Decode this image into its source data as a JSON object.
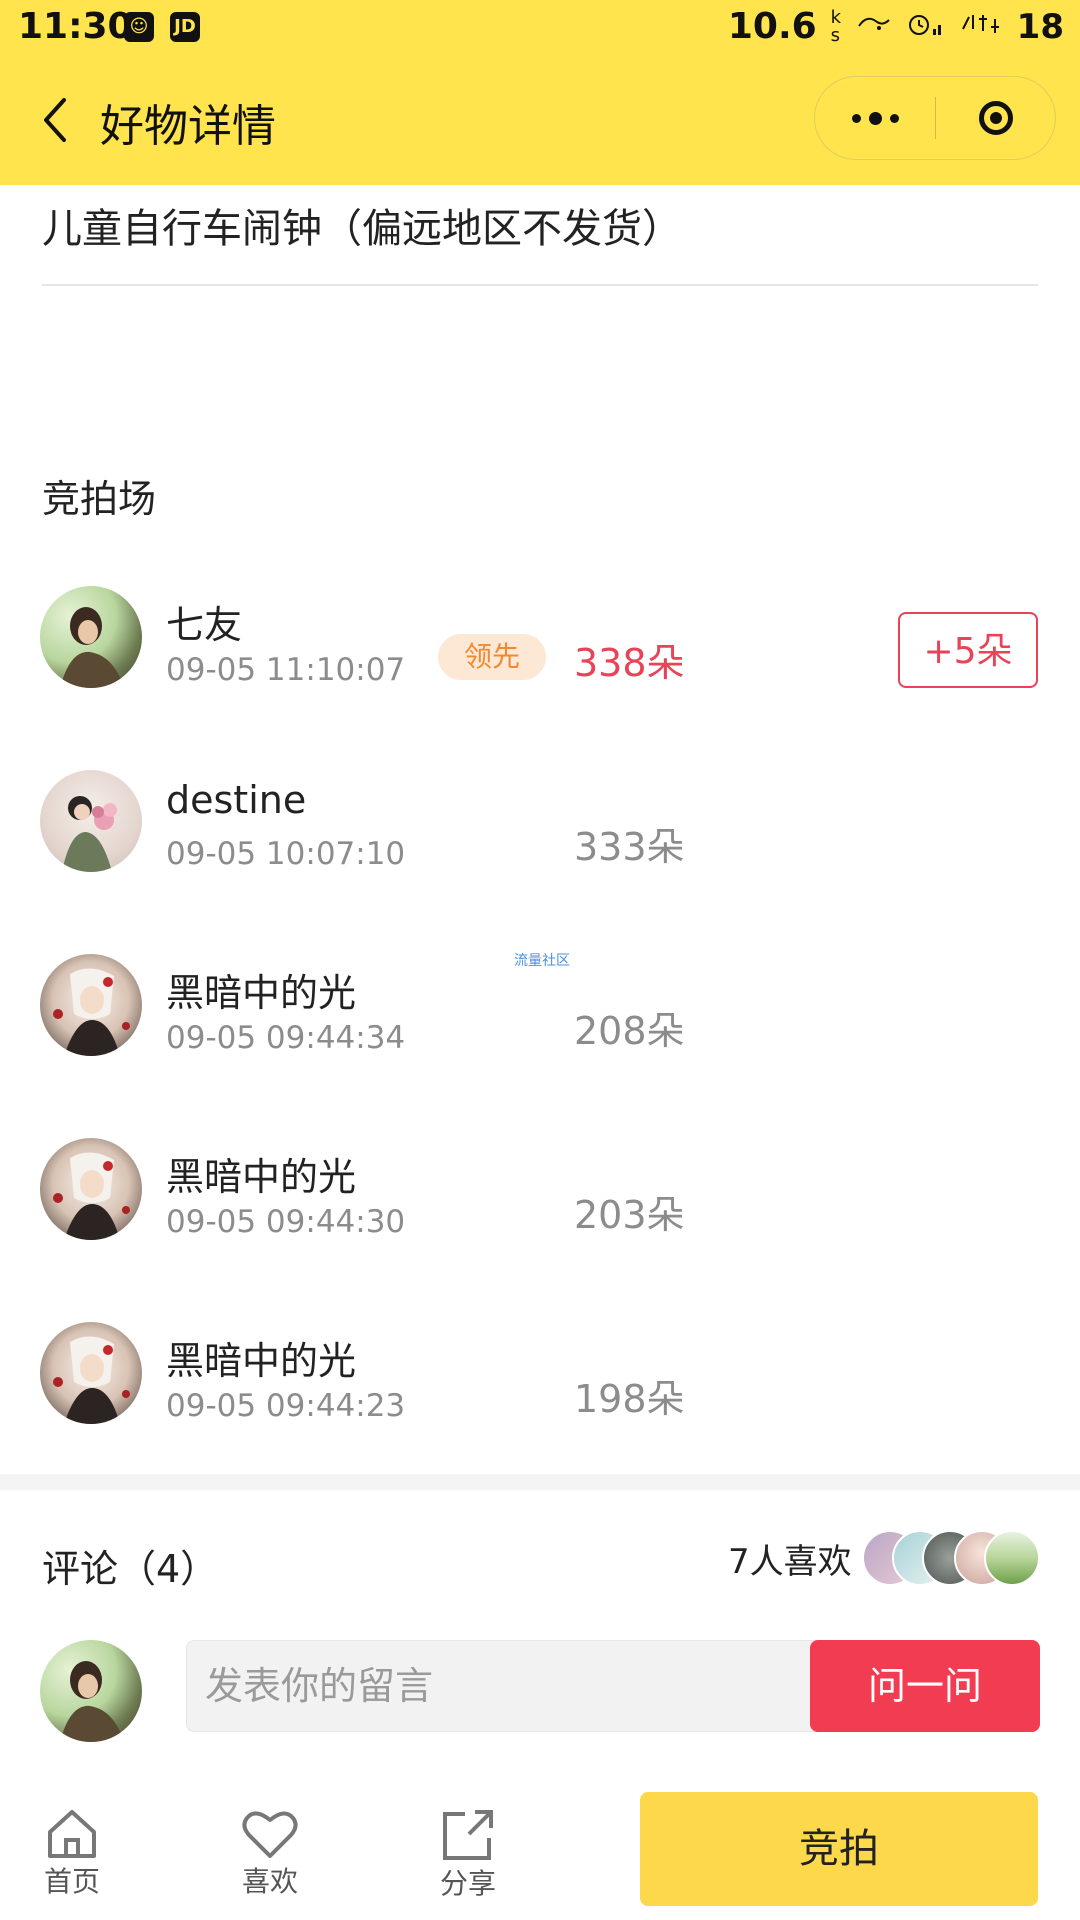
{
  "status_bar": {
    "time": "11:30",
    "app_icons": [
      "qq-icon",
      "JD"
    ],
    "speed": "10.6",
    "speed_unit_top": "k",
    "speed_unit_bottom": "s",
    "battery": "18"
  },
  "navbar": {
    "title": "好物详情",
    "back_icon": "chevron-left-icon",
    "more_icon": "more-dots-icon",
    "close_icon": "target-close-icon"
  },
  "product": {
    "title": "儿童自行车闹钟（偏远地区不发货）"
  },
  "auction": {
    "section_title": "竞拍场",
    "lead_label": "领先",
    "raise_button": "+5朵",
    "bids": [
      {
        "name": "七友",
        "time": "09-05 11:10:07",
        "amount": "338朵",
        "leading": true
      },
      {
        "name": "destine",
        "time": "09-05 10:07:10",
        "amount": "333朵",
        "leading": false
      },
      {
        "name": "黑暗中的光",
        "time": "09-05 09:44:34",
        "amount": "208朵",
        "leading": false
      },
      {
        "name": "黑暗中的光",
        "time": "09-05 09:44:30",
        "amount": "203朵",
        "leading": false
      },
      {
        "name": "黑暗中的光",
        "time": "09-05 09:44:23",
        "amount": "198朵",
        "leading": false
      }
    ]
  },
  "watermark": "流量社区",
  "comments": {
    "title": "评论（4）",
    "likes_text": "7人喜欢",
    "input_placeholder": "发表你的留言",
    "ask_button": "问一问"
  },
  "bottom_bar": {
    "home_label": "首页",
    "like_label": "喜欢",
    "share_label": "分享",
    "bid_button": "竞拍"
  },
  "colors": {
    "header_bg": "#ffe44d",
    "accent_red": "#e84356",
    "lead_badge_bg": "#fde7d5",
    "lead_badge_text": "#f3892f",
    "bid_button_bg": "#fdd84a"
  }
}
